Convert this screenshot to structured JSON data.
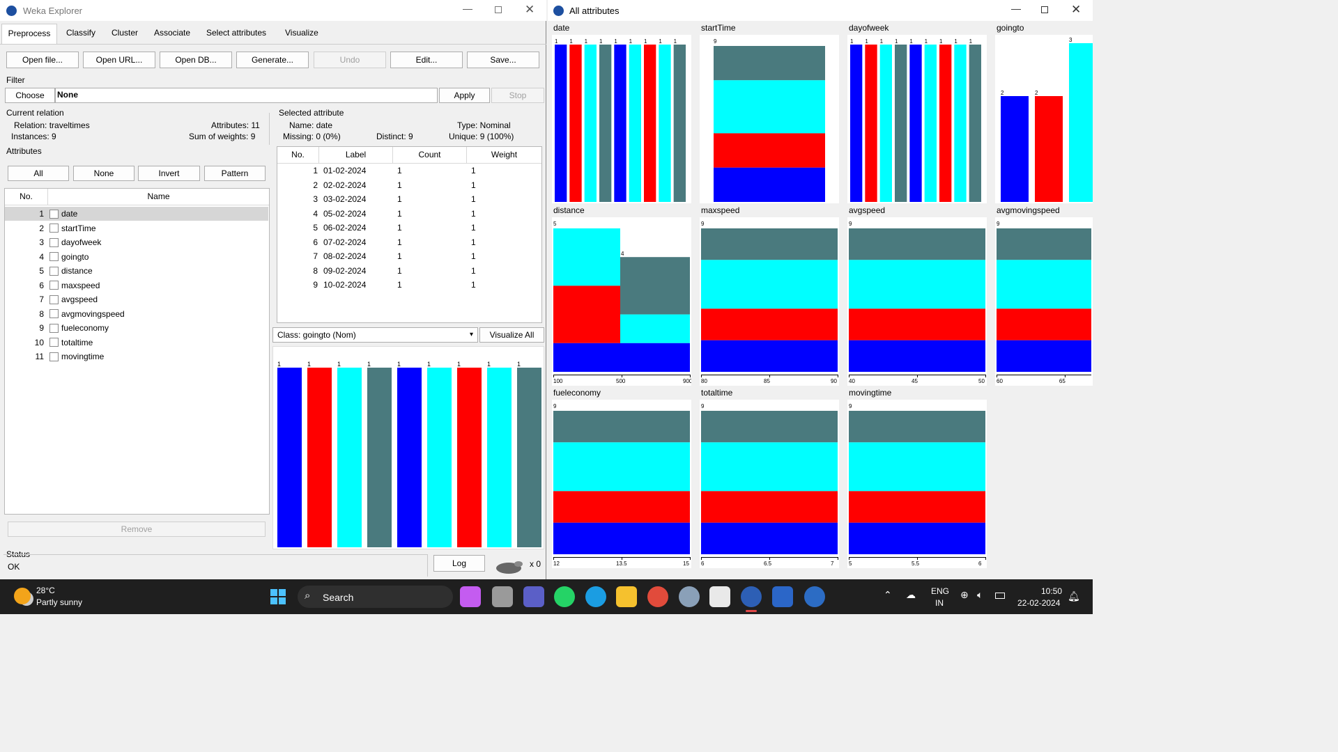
{
  "left_window": {
    "title": "Weka Explorer",
    "tabs": [
      "Preprocess",
      "Classify",
      "Cluster",
      "Associate",
      "Select attributes",
      "Visualize"
    ],
    "toolbar": {
      "open_file": "Open file...",
      "open_url": "Open URL...",
      "open_db": "Open DB...",
      "generate": "Generate...",
      "undo": "Undo",
      "edit": "Edit...",
      "save": "Save..."
    },
    "filter": {
      "label": "Filter",
      "choose": "Choose",
      "value": "None",
      "apply": "Apply",
      "stop": "Stop"
    },
    "relation": {
      "title": "Current relation",
      "relation": "Relation: traveltimes",
      "attributes": "Attributes: 11",
      "instances": "Instances: 9",
      "weights": "Sum of weights: 9"
    },
    "attributes": {
      "title": "Attributes",
      "all": "All",
      "none": "None",
      "invert": "Invert",
      "pattern": "Pattern",
      "col_no": "No.",
      "col_name": "Name",
      "remove": "Remove",
      "items": [
        {
          "no": "1",
          "name": "date"
        },
        {
          "no": "2",
          "name": "startTime"
        },
        {
          "no": "3",
          "name": "dayofweek"
        },
        {
          "no": "4",
          "name": "goingto"
        },
        {
          "no": "5",
          "name": "distance"
        },
        {
          "no": "6",
          "name": "maxspeed"
        },
        {
          "no": "7",
          "name": "avgspeed"
        },
        {
          "no": "8",
          "name": "avgmovingspeed"
        },
        {
          "no": "9",
          "name": "fueleconomy"
        },
        {
          "no": "10",
          "name": "totaltime"
        },
        {
          "no": "11",
          "name": "movingtime"
        }
      ]
    },
    "selected": {
      "title": "Selected attribute",
      "name": "Name: date",
      "type": "Type: Nominal",
      "missing": "Missing: 0 (0%)",
      "distinct": "Distinct: 9",
      "unique": "Unique: 9 (100%)",
      "cols": [
        "No.",
        "Label",
        "Count",
        "Weight"
      ],
      "rows": [
        [
          "1",
          "01-02-2024",
          "1",
          "1"
        ],
        [
          "2",
          "02-02-2024",
          "1",
          "1"
        ],
        [
          "3",
          "03-02-2024",
          "1",
          "1"
        ],
        [
          "4",
          "05-02-2024",
          "1",
          "1"
        ],
        [
          "5",
          "06-02-2024",
          "1",
          "1"
        ],
        [
          "6",
          "07-02-2024",
          "1",
          "1"
        ],
        [
          "7",
          "08-02-2024",
          "1",
          "1"
        ],
        [
          "8",
          "09-02-2024",
          "1",
          "1"
        ],
        [
          "9",
          "10-02-2024",
          "1",
          "1"
        ]
      ]
    },
    "class_select": "Class: goingto (Nom)",
    "visualize_all": "Visualize All",
    "histogram_counts": [
      "1",
      "1",
      "1",
      "1",
      "1",
      "1",
      "1",
      "1",
      "1"
    ],
    "histogram_colors": [
      "#0000ff",
      "#ff0000",
      "#00ffff",
      "#4a7a7e",
      "#0000ff",
      "#00ffff",
      "#ff0000",
      "#00ffff",
      "#4a7a7e"
    ],
    "status": {
      "title": "Status",
      "text": "OK",
      "log": "Log",
      "count": "x 0"
    }
  },
  "right_window": {
    "title": "All attributes",
    "panels": [
      {
        "name": "date",
        "counts": [
          "1",
          "1",
          "1",
          "1",
          "1",
          "1",
          "1",
          "1",
          "1"
        ]
      },
      {
        "name": "startTime",
        "counts": [
          "9"
        ]
      },
      {
        "name": "dayofweek",
        "counts": [
          "1",
          "1",
          "1",
          "1",
          "1",
          "1",
          "1",
          "1",
          "1"
        ]
      },
      {
        "name": "goingto",
        "counts": [
          "2",
          "2",
          "3"
        ]
      },
      {
        "name": "distance",
        "counts": [
          "5",
          "4"
        ],
        "ticks": [
          "100",
          "500",
          "900"
        ]
      },
      {
        "name": "maxspeed",
        "counts": [
          "9"
        ],
        "ticks": [
          "80",
          "85",
          "90"
        ]
      },
      {
        "name": "avgspeed",
        "counts": [
          "9"
        ],
        "ticks": [
          "40",
          "45",
          "50"
        ]
      },
      {
        "name": "avgmovingspeed",
        "counts": [
          "9"
        ],
        "ticks": [
          "60",
          "65"
        ]
      },
      {
        "name": "fueleconomy",
        "counts": [
          "9"
        ],
        "ticks": [
          "12",
          "13.5",
          "15"
        ]
      },
      {
        "name": "totaltime",
        "counts": [
          "9"
        ],
        "ticks": [
          "6",
          "6.5",
          "7"
        ]
      },
      {
        "name": "movingtime",
        "counts": [
          "9"
        ],
        "ticks": [
          "5",
          "5.5",
          "6"
        ]
      }
    ]
  },
  "colors": {
    "blue": "#0000ff",
    "red": "#ff0000",
    "cyan": "#00ffff",
    "slate": "#4a7a7e"
  },
  "taskbar": {
    "weather_temp": "28°C",
    "weather_desc": "Partly sunny",
    "search": "Search",
    "lang1": "ENG",
    "lang2": "IN",
    "time": "10:50",
    "date": "22-02-2024"
  }
}
